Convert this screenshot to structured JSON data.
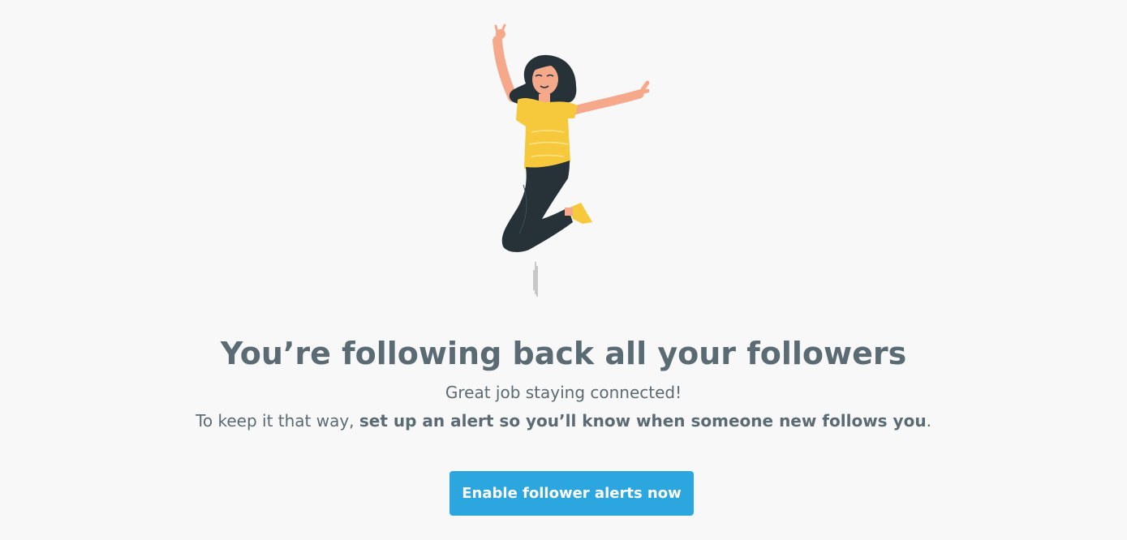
{
  "illustration": {
    "icon": "jumping-woman-illustration",
    "colors": {
      "shirt": "#f5c93b",
      "pants": "#263238",
      "skin": "#f5a88a",
      "hair": "#263238",
      "shoe": "#f5c93b"
    }
  },
  "message": {
    "headline": "You’re following back all your followers",
    "subline": "Great job staying connected!",
    "detail_prefix": "To keep it that way, ",
    "detail_bold": "set up an alert so you’ll know when someone new follows you",
    "detail_suffix": "."
  },
  "cta": {
    "label": "Enable follower alerts now",
    "color": "#2ba6df"
  }
}
